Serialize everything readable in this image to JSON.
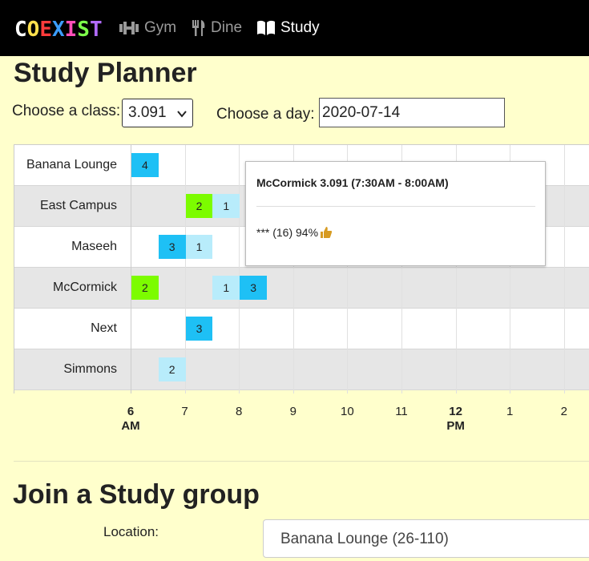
{
  "nav": {
    "logo_letters": [
      "C",
      "O",
      "E",
      "X",
      "I",
      "S",
      "T"
    ],
    "logo_colors": [
      "#ffffff",
      "#ffe14d",
      "#ff3b3b",
      "#3b9dff",
      "#ff4fb8",
      "#7dff4a",
      "#b26bff"
    ],
    "items": [
      {
        "label": "Gym",
        "icon": "dumbbell-icon",
        "active": false
      },
      {
        "label": "Dine",
        "icon": "utensils-icon",
        "active": false
      },
      {
        "label": "Study",
        "icon": "book-icon",
        "active": true
      }
    ]
  },
  "page_title": "Study Planner",
  "filters": {
    "class_label": "Choose a class:",
    "class_value": "3.091",
    "day_label": "Choose a day:",
    "day_value": "2020-07-14"
  },
  "timeline": {
    "rows": [
      "Banana Lounge",
      "East Campus",
      "Maseeh",
      "McCormick",
      "Next",
      "Simmons"
    ],
    "axis": [
      {
        "line1": "6",
        "line2": "AM",
        "bold": true
      },
      {
        "line1": "7",
        "line2": "",
        "bold": false
      },
      {
        "line1": "8",
        "line2": "",
        "bold": false
      },
      {
        "line1": "9",
        "line2": "",
        "bold": false
      },
      {
        "line1": "10",
        "line2": "",
        "bold": false
      },
      {
        "line1": "11",
        "line2": "",
        "bold": false
      },
      {
        "line1": "12",
        "line2": "PM",
        "bold": true
      },
      {
        "line1": "1",
        "line2": "",
        "bold": false
      },
      {
        "line1": "2",
        "line2": "",
        "bold": false
      }
    ],
    "blocks": [
      {
        "row": 0,
        "start": "6:00",
        "end": "6:30",
        "count": "4",
        "color": "#1ec0f5"
      },
      {
        "row": 1,
        "start": "7:00",
        "end": "7:30",
        "count": "2",
        "color": "#7cfc00"
      },
      {
        "row": 1,
        "start": "7:30",
        "end": "8:00",
        "count": "1",
        "color": "#b8ecfb"
      },
      {
        "row": 2,
        "start": "6:30",
        "end": "7:00",
        "count": "3",
        "color": "#1ec0f5"
      },
      {
        "row": 2,
        "start": "7:00",
        "end": "7:30",
        "count": "1",
        "color": "#b8ecfb"
      },
      {
        "row": 3,
        "start": "6:00",
        "end": "6:30",
        "count": "2",
        "color": "#7cfc00"
      },
      {
        "row": 3,
        "start": "7:30",
        "end": "8:00",
        "count": "1",
        "color": "#b8ecfb"
      },
      {
        "row": 3,
        "start": "8:00",
        "end": "8:30",
        "count": "3",
        "color": "#1ec0f5"
      },
      {
        "row": 4,
        "start": "7:00",
        "end": "7:30",
        "count": "3",
        "color": "#1ec0f5"
      },
      {
        "row": 5,
        "start": "6:30",
        "end": "7:00",
        "count": "2",
        "color": "#b8ecfb"
      }
    ]
  },
  "tooltip": {
    "title": "McCormick 3.091 (7:30AM - 8:00AM)",
    "body": "*** (16) 94%",
    "icon": "thumbs-up-icon"
  },
  "join": {
    "title": "Join a Study group",
    "location_label": "Location:",
    "location_value": "Banana Lounge (26-110)"
  }
}
